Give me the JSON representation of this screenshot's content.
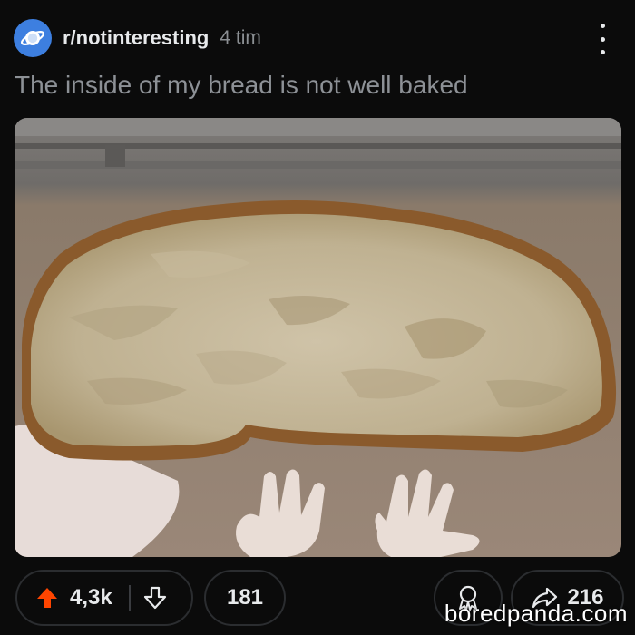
{
  "post": {
    "subreddit": "r/notinteresting",
    "age": "4 tim",
    "title": "The inside of my bread is not well baked"
  },
  "actions": {
    "score": "4,3k",
    "comments": "181",
    "shares": "216"
  },
  "watermark": "boredpanda.com",
  "icons": {
    "subreddit": "planet-icon",
    "more": "kebab-menu-icon",
    "upvote": "up-arrow-icon",
    "downvote": "down-arrow-icon",
    "award": "award-icon",
    "share": "share-arrow-icon"
  },
  "colors": {
    "background": "#0b0b0b",
    "upvote_active": "#ff4500",
    "avatar": "#3d7fe0"
  }
}
